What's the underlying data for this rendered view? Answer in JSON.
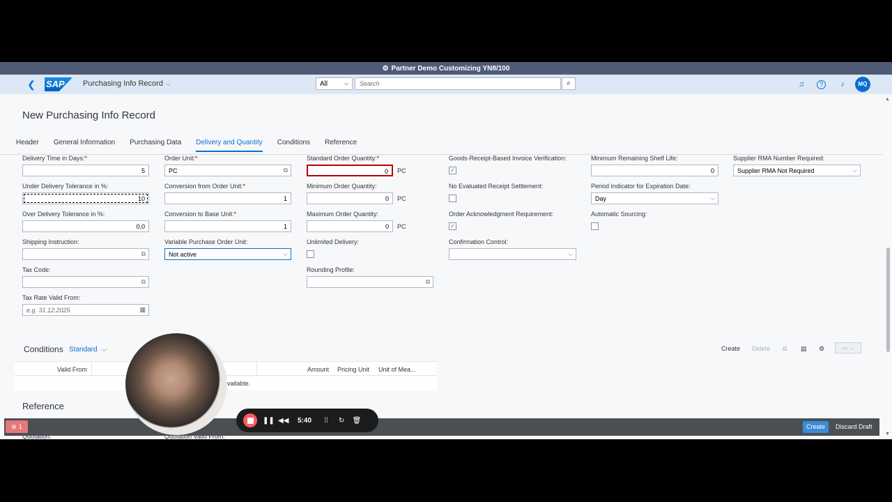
{
  "system": {
    "title": "Partner Demo Customizing YN8/100"
  },
  "shell": {
    "logo": "SAP",
    "app_title": "Purchasing Info Record",
    "search_scope": "All",
    "search_placeholder": "Search",
    "avatar_initials": "MQ",
    "icons": [
      "back-icon",
      "headset-icon",
      "help-icon",
      "bell-icon",
      "search-icon"
    ]
  },
  "page": {
    "title": "New Purchasing Info Record",
    "tabs": [
      "Header",
      "General Information",
      "Purchasing Data",
      "Delivery and Quantity",
      "Conditions",
      "Reference"
    ],
    "active_tab": "Delivery and Quantity"
  },
  "fields": {
    "delivery_time": {
      "label": "Delivery Time in Days:",
      "value": "5",
      "required": "*"
    },
    "under_tol": {
      "label": "Under Delivery Tolerance in %:",
      "value": "10"
    },
    "over_tol": {
      "label": "Over Delivery Tolerance in %:",
      "value": "0,0"
    },
    "shipping": {
      "label": "Shipping Instruction:",
      "value": ""
    },
    "tax_code": {
      "label": "Tax Code:",
      "value": ""
    },
    "tax_rate": {
      "label": "Tax Rate Valid From:",
      "placeholder": "e.g. 31.12.2025"
    },
    "order_unit": {
      "label": "Order Unit:",
      "value": "PC",
      "required": "*"
    },
    "conv_order": {
      "label": "Conversion from Order Unit:",
      "value": "1",
      "required": "*"
    },
    "conv_base": {
      "label": "Conversion to Base Unit:",
      "value": "1",
      "required": "*"
    },
    "var_po_unit": {
      "label": "Variable Purchase Order Unit:",
      "value": "Not active"
    },
    "std_qty": {
      "label": "Standard Order Quantity:",
      "value": "0",
      "unit": "PC",
      "required": "*"
    },
    "min_qty": {
      "label": "Minimum Order Quantity:",
      "value": "0",
      "unit": "PC"
    },
    "max_qty": {
      "label": "Maximum Order Quantity:",
      "value": "0",
      "unit": "PC"
    },
    "unlimited": {
      "label": "Unlimited Delivery:",
      "checked": false
    },
    "rounding": {
      "label": "Rounding Profile:",
      "value": ""
    },
    "gr_iv": {
      "label": "Goods-Receipt-Based Invoice Verification:",
      "checked": true
    },
    "no_ers": {
      "label": "No Evaluated Receipt Settlement:",
      "checked": false
    },
    "ack_req": {
      "label": "Order Acknowledgment Requirement:",
      "checked": true
    },
    "conf_control": {
      "label": "Confirmation Control:",
      "value": ""
    },
    "min_shelf": {
      "label": "Minimum Remaining Shelf Life:",
      "value": "0"
    },
    "period_ind": {
      "label": "Period Indicator for Expiration Date:",
      "value": "Day"
    },
    "auto_sourcing": {
      "label": "Automatic Sourcing:",
      "checked": false
    },
    "rma": {
      "label": "Supplier RMA Number Required:",
      "value": "Supplier RMA Not Required"
    }
  },
  "conditions": {
    "title": "Conditions",
    "variant": "Standard",
    "toolbar": {
      "create": "Create",
      "delete": "Delete"
    },
    "columns": [
      "Valid From",
      "Amount",
      "Pricing Unit",
      "Unit of Mea..."
    ],
    "no_data": "available."
  },
  "reference": {
    "title": "Reference",
    "labels": [
      "Quotation:",
      "Quotation Valid From:"
    ]
  },
  "footer": {
    "message_count": "1",
    "create": "Create",
    "discard": "Discard Draft"
  },
  "recorder": {
    "time": "5:40"
  }
}
